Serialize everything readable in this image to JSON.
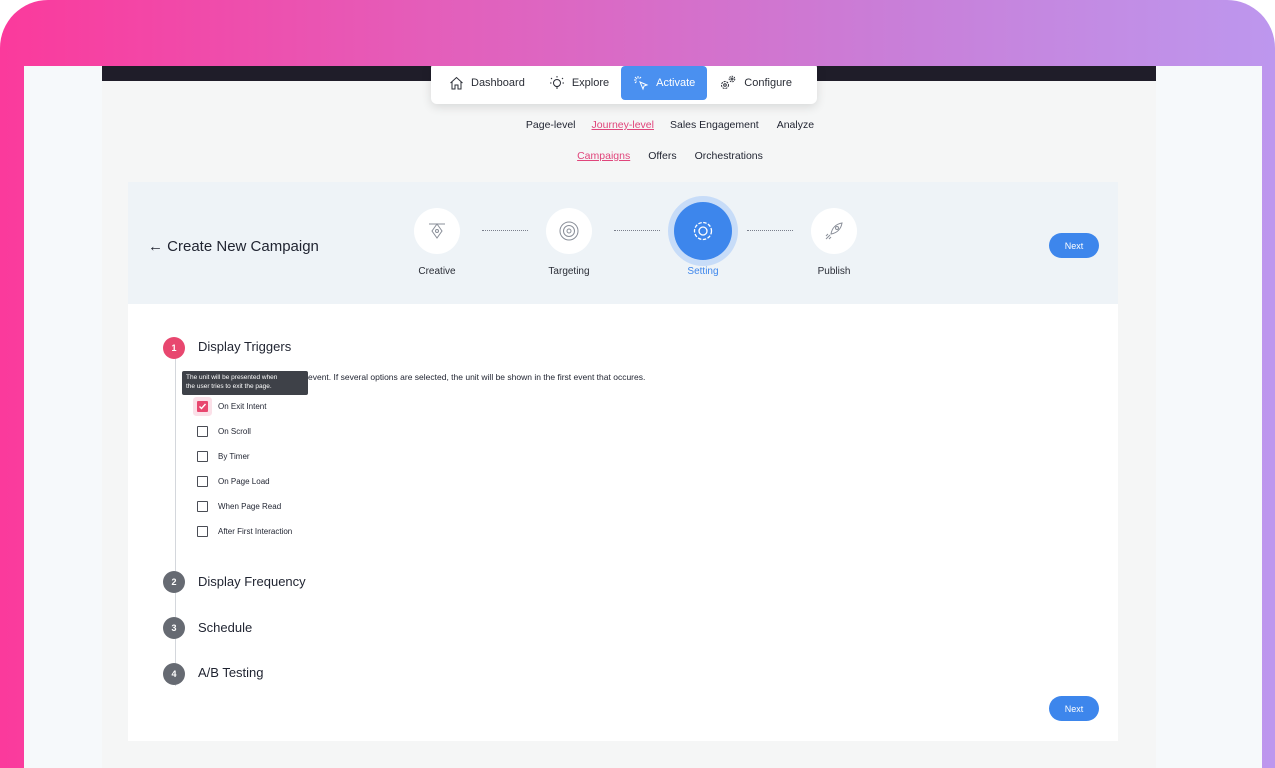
{
  "nav": {
    "items": [
      {
        "label": "Dashboard",
        "icon": "home-icon"
      },
      {
        "label": "Explore",
        "icon": "lightbulb-icon"
      },
      {
        "label": "Activate",
        "icon": "cursor-click-icon",
        "active": true
      },
      {
        "label": "Configure",
        "icon": "gears-icon"
      }
    ]
  },
  "subnav1": {
    "items": [
      {
        "label": "Page-level"
      },
      {
        "label": "Journey-level",
        "selected": true
      },
      {
        "label": "Sales Engagement"
      },
      {
        "label": "Analyze"
      }
    ]
  },
  "subnav2": {
    "items": [
      {
        "label": "Campaigns",
        "selected": true
      },
      {
        "label": "Offers"
      },
      {
        "label": "Orchestrations"
      }
    ]
  },
  "wizard": {
    "back_label": "← Create New Campaign",
    "steps": [
      {
        "label": "Creative",
        "icon": "pen-tool-icon"
      },
      {
        "label": "Targeting",
        "icon": "target-icon"
      },
      {
        "label": "Setting",
        "icon": "settings-gear-icon",
        "active": true
      },
      {
        "label": "Publish",
        "icon": "rocket-icon"
      }
    ],
    "next_label": "Next"
  },
  "sections": [
    {
      "num": "1",
      "title": "Display Triggers",
      "active": true
    },
    {
      "num": "2",
      "title": "Display Frequency"
    },
    {
      "num": "3",
      "title": "Schedule"
    },
    {
      "num": "4",
      "title": "A/B Testing"
    }
  ],
  "triggers": {
    "description": "event. If several options are selected, the unit will be shown in the first event that occures.",
    "tooltip_line1": "The unit will be presented when",
    "tooltip_line2": "the user tries to exit the page.",
    "options": [
      {
        "label": "On Exit Intent",
        "checked": true
      },
      {
        "label": "On Scroll",
        "checked": false
      },
      {
        "label": "By Timer",
        "checked": false
      },
      {
        "label": "On Page Load",
        "checked": false
      },
      {
        "label": "When Page Read",
        "checked": false
      },
      {
        "label": "After First Interaction",
        "checked": false
      }
    ]
  },
  "footer": {
    "next_label": "Next"
  },
  "colors": {
    "accent_blue": "#3d86ec",
    "accent_pink": "#e8476f",
    "gradient_start": "#fb3a9c",
    "gradient_end": "#bd97ee"
  }
}
